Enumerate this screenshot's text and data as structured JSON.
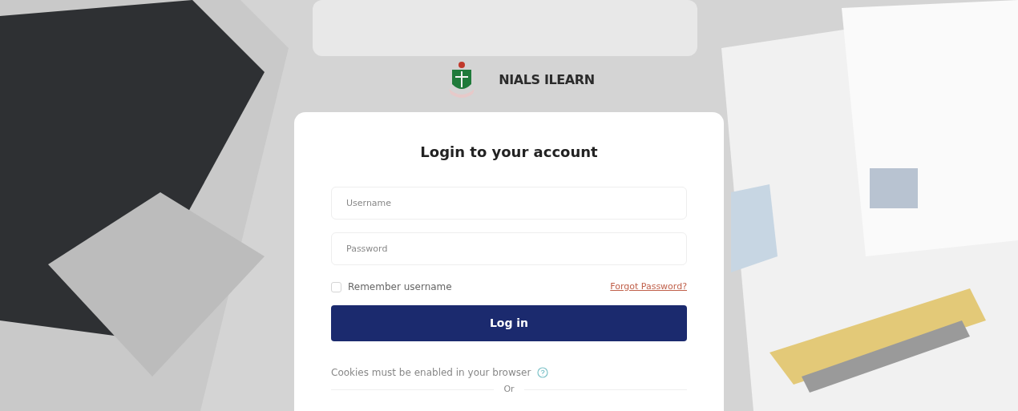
{
  "brand": {
    "name": "NIALS ILEARN"
  },
  "login": {
    "title": "Login to your account",
    "username": {
      "placeholder": "Username"
    },
    "password": {
      "placeholder": "Password"
    },
    "remember": {
      "label": "Remember username",
      "checked": false
    },
    "forgot_link": "Forgot Password?",
    "submit": "Log in",
    "cookies_notice": "Cookies must be enabled in your browser",
    "divider": "Or"
  }
}
